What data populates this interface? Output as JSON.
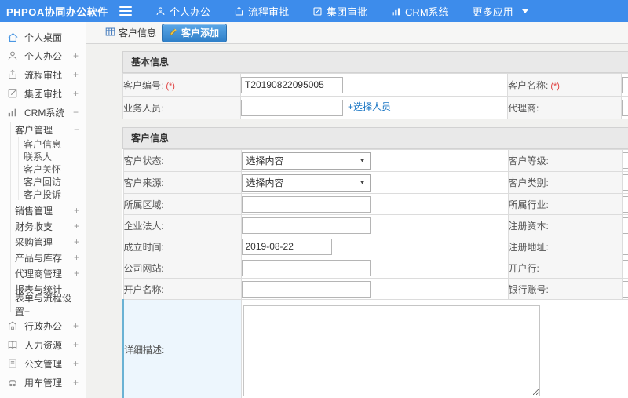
{
  "colors": {
    "accent": "#3d8ceb",
    "tab_active": "#2f80c9",
    "required": "#e04343",
    "link": "#1a76c4",
    "hover_row": "#edf6fd",
    "hover_border": "#6ab2d4"
  },
  "navbar": {
    "logo": "PHPOA协同办公软件",
    "items": [
      {
        "label": "个人办公",
        "icon": "user-icon"
      },
      {
        "label": "流程审批",
        "icon": "flow-icon"
      },
      {
        "label": "集团审批",
        "icon": "edit-icon"
      },
      {
        "label": "CRM系统",
        "icon": "chart-icon"
      },
      {
        "label": "更多应用",
        "icon": "caret-down-icon"
      }
    ]
  },
  "sidebar": {
    "items": [
      {
        "label": "个人桌面",
        "icon": "home-icon",
        "level": 1
      },
      {
        "label": "个人办公",
        "icon": "user-icon",
        "level": 1,
        "expand": "+"
      },
      {
        "label": "流程审批",
        "icon": "flow-icon",
        "level": 1,
        "expand": "+"
      },
      {
        "label": "集团审批",
        "icon": "edit-icon",
        "level": 1,
        "expand": "+"
      },
      {
        "label": "CRM系统",
        "icon": "chart-icon",
        "level": 1,
        "expand": "−"
      },
      {
        "label": "客户管理",
        "level": 2,
        "expand": "−"
      },
      {
        "label": "客户信息",
        "level": 3
      },
      {
        "label": "联系人",
        "level": 3
      },
      {
        "label": "客户关怀",
        "level": 3
      },
      {
        "label": "客户回访",
        "level": 3
      },
      {
        "label": "客户投诉",
        "level": 3
      },
      {
        "label": "销售管理",
        "level": 2,
        "expand": "+"
      },
      {
        "label": "财务收支",
        "level": 2,
        "expand": "+"
      },
      {
        "label": "采购管理",
        "level": 2,
        "expand": "+"
      },
      {
        "label": "产品与库存",
        "level": 2,
        "expand": "+"
      },
      {
        "label": "代理商管理",
        "level": 2,
        "expand": "+"
      },
      {
        "label": "报表与统计",
        "level": 2
      },
      {
        "label": "表单与流程设置+",
        "level": 2
      },
      {
        "label": "行政办公",
        "icon": "building-icon",
        "level": 1,
        "expand": "+"
      },
      {
        "label": "人力资源",
        "icon": "book-icon",
        "level": 1,
        "expand": "+"
      },
      {
        "label": "公文管理",
        "icon": "document-icon",
        "level": 1,
        "expand": "+"
      },
      {
        "label": "用车管理",
        "icon": "car-icon",
        "level": 1,
        "expand": "+"
      }
    ]
  },
  "tabs": {
    "items": [
      {
        "label": "客户信息",
        "icon": "grid-icon",
        "active": false
      },
      {
        "label": "客户添加",
        "icon": "pencil-icon",
        "active": true
      }
    ]
  },
  "form": {
    "sections": [
      {
        "title": "基本信息",
        "rows": [
          {
            "label1": "客户编号:",
            "req1": "(*)",
            "value1": "T20190822095005",
            "label2": "客户名称:",
            "req2": "(*)"
          },
          {
            "label1": "业务人员:",
            "value1": "",
            "link": "+选择人员",
            "label2": "代理商:"
          }
        ]
      },
      {
        "title": "客户信息",
        "rows": [
          {
            "label1": "客户状态:",
            "select1": "选择内容",
            "label2": "客户等级:"
          },
          {
            "label1": "客户来源:",
            "select1": "选择内容",
            "label2": "客户类别:"
          },
          {
            "label1": "所属区域:",
            "label2": "所属行业:"
          },
          {
            "label1": "企业法人:",
            "label2": "注册资本:"
          },
          {
            "label1": "成立时间:",
            "value1": "2019-08-22",
            "label2": "注册地址:"
          },
          {
            "label1": "公司网站:",
            "label2": "开户行:"
          },
          {
            "label1": "开户名称:",
            "label2": "银行账号:"
          },
          {
            "label1": "详细描述:"
          }
        ]
      }
    ]
  }
}
